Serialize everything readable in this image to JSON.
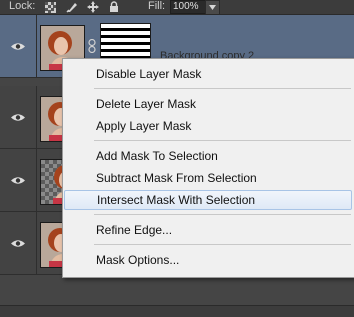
{
  "toolbar": {
    "lock_label": "Lock:",
    "lock_icons": [
      "lock-transparent-pixels-icon",
      "lock-image-pixels-icon",
      "lock-position-icon",
      "lock-all-icon"
    ],
    "fill_label": "Fill:",
    "fill_value": "100%"
  },
  "layers": [
    {
      "name": "Background copy 2",
      "selected": true,
      "has_mask": true
    },
    {
      "name": "",
      "selected": false,
      "has_mask": false
    },
    {
      "name": "",
      "selected": false,
      "has_mask": false
    },
    {
      "name": "",
      "selected": false,
      "has_mask": false
    }
  ],
  "context_menu": {
    "items": [
      {
        "label": "Disable Layer Mask"
      },
      {
        "label": "Delete Layer Mask"
      },
      {
        "label": "Apply Layer Mask"
      },
      {
        "label": "Add Mask To Selection"
      },
      {
        "label": "Subtract Mask From Selection"
      },
      {
        "label": "Intersect Mask With Selection",
        "highlighted": true
      },
      {
        "label": "Refine Edge..."
      },
      {
        "label": "Mask Options..."
      }
    ]
  },
  "colors": {
    "panel_bg": "#454545",
    "selected_row": "#596b85",
    "menu_bg": "#f0f0f0",
    "menu_highlight_border": "#a8c4e6"
  }
}
